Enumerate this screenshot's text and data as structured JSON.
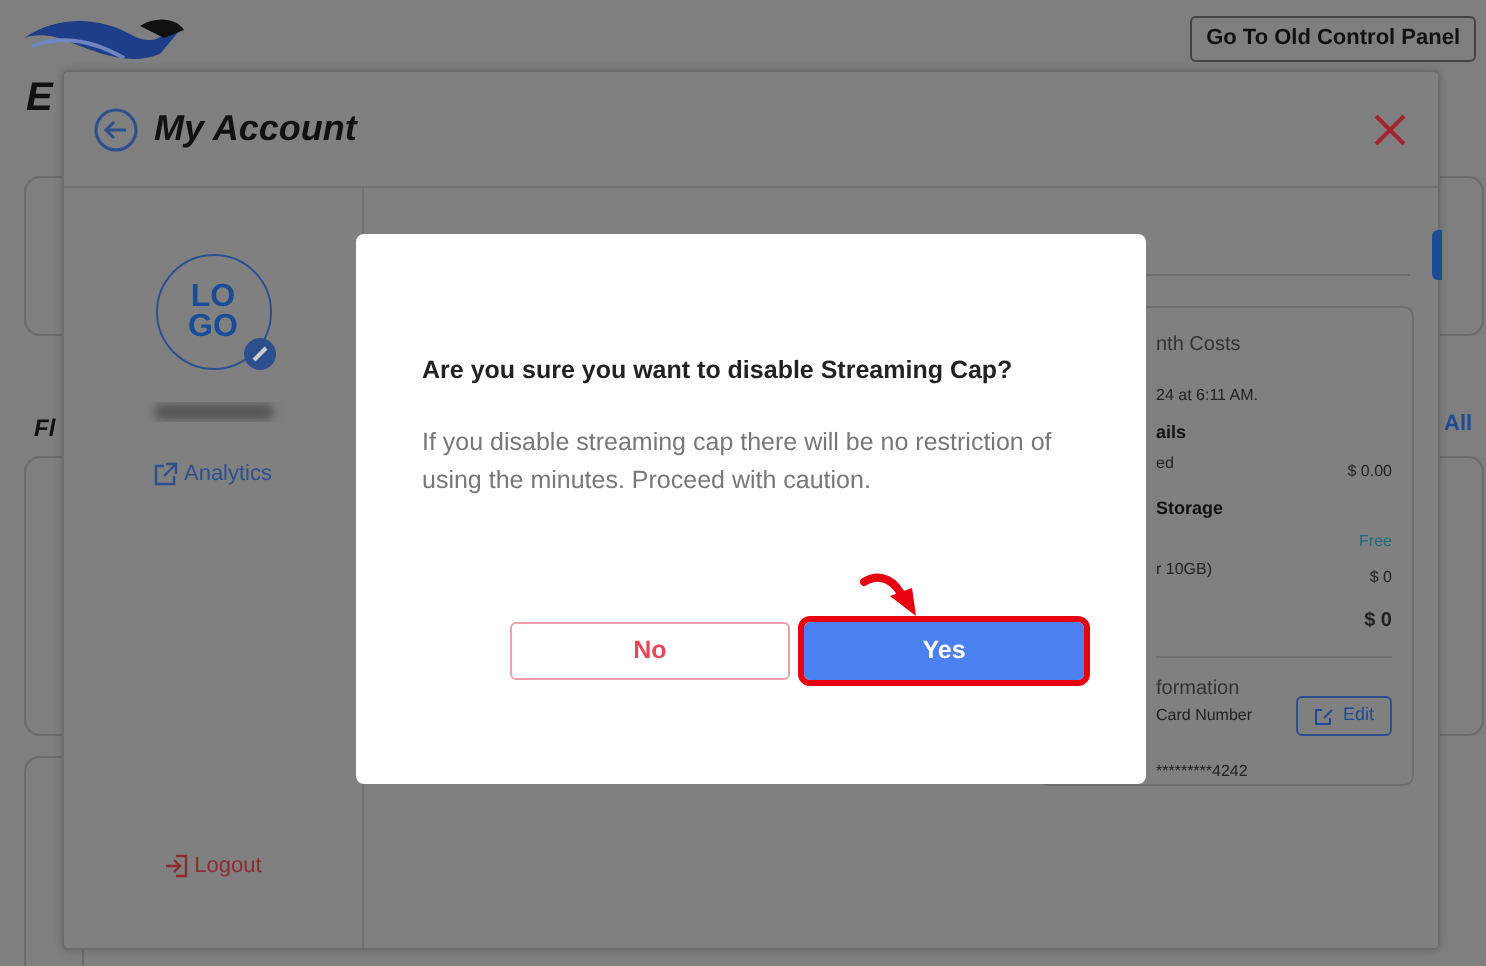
{
  "background": {
    "brand_partial": "E",
    "section_partial": "Fl",
    "view_all_partial": "All",
    "old_panel_button": "Go To Old Control Panel"
  },
  "account_modal": {
    "title": "My Account",
    "sidebar": {
      "logo_lines": [
        "LO",
        "GO"
      ],
      "links": [
        {
          "kind": "analytics",
          "label": "Analytics"
        },
        {
          "kind": "logout",
          "label": "Logout"
        }
      ]
    },
    "billing_card": {
      "rows": [
        {
          "kind": "heading",
          "left": "nth Costs"
        },
        {
          "kind": "note",
          "left": "24 at 6:11 AM."
        },
        {
          "kind": "section",
          "left": "ails"
        },
        {
          "kind": "line",
          "left": "ed",
          "right": "$ 0.00"
        },
        {
          "kind": "section",
          "left": "Storage"
        },
        {
          "kind": "tag",
          "right": "Free"
        },
        {
          "kind": "line",
          "left": "r 10GB)",
          "right": "$ 0"
        },
        {
          "kind": "total",
          "right": "$ 0"
        },
        {
          "kind": "divider"
        },
        {
          "kind": "heading",
          "left": "formation"
        },
        {
          "kind": "label",
          "left": "Card Number",
          "action": "Edit"
        },
        {
          "kind": "note",
          "left": "*********4242"
        }
      ]
    }
  },
  "confirm_dialog": {
    "title": "Are you sure you want to disable Streaming Cap?",
    "message": "If you disable streaming cap there will be no restriction of using the minutes. Proceed with caution.",
    "buttons": [
      {
        "kind": "secondary",
        "label": "No",
        "highlighted": false
      },
      {
        "kind": "primary",
        "label": "Yes",
        "highlighted": true
      }
    ]
  }
}
